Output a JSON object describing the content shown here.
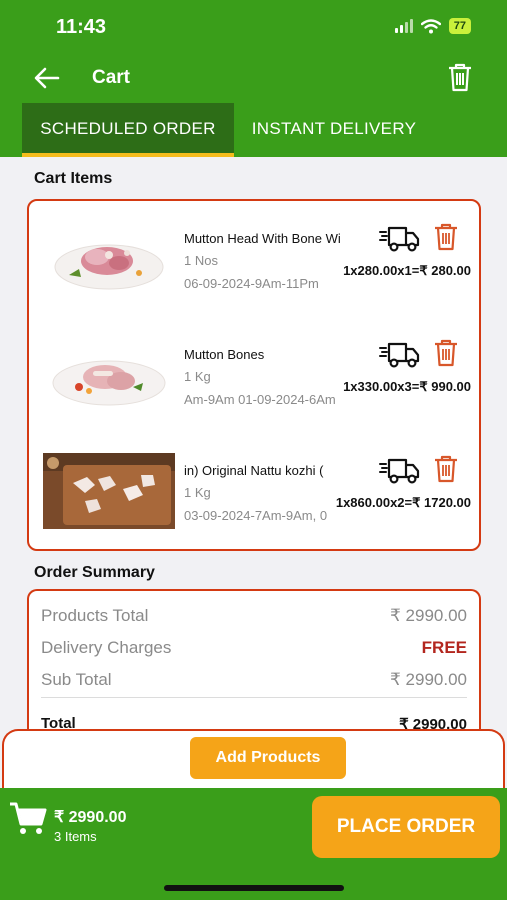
{
  "status": {
    "time": "11:43",
    "battery": "77"
  },
  "header": {
    "title": "Cart"
  },
  "tabs": [
    {
      "label": "SCHEDULED ORDER",
      "active": true
    },
    {
      "label": "INSTANT DELIVERY",
      "active": false
    }
  ],
  "cart": {
    "title": "Cart Items",
    "items": [
      {
        "name": "Mutton Head With Bone Wi",
        "qty": "1 Nos",
        "date": "06-09-2024-9Am-11Pm",
        "price": "1x280.00x1=₹ 280.00"
      },
      {
        "name": "Mutton Bones",
        "qty": "1 Kg",
        "date": "Am-9Am     01-09-2024-6Am",
        "price": "1x330.00x3=₹ 990.00"
      },
      {
        "name": "in)     Original Nattu kozhi (",
        "qty": "1 Kg",
        "date": "03-09-2024-7Am-9Am, 0",
        "price": "1x860.00x2=₹ 1720.00"
      }
    ]
  },
  "summary": {
    "title": "Order Summary",
    "products_total_label": "Products Total",
    "products_total_value": "₹ 2990.00",
    "delivery_label": "Delivery Charges",
    "delivery_value": "FREE",
    "subtotal_label": "Sub Total",
    "subtotal_value": "₹ 2990.00",
    "total_label": "Total",
    "total_value": "₹ 2990.00"
  },
  "add_products_label": "Add Products",
  "bottom": {
    "amount": "₹ 2990.00",
    "items": "3 Items",
    "place_order_label": "PLACE ORDER"
  },
  "colors": {
    "primary": "#3a9e1a",
    "accent": "#f5a418",
    "border": "#d43a12",
    "free": "#b3261e"
  },
  "icons": [
    "back-arrow-icon",
    "trash-icon",
    "truck-icon",
    "cart-icon"
  ]
}
